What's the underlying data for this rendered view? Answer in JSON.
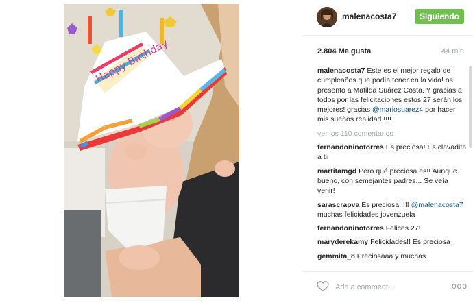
{
  "post": {
    "username": "malenacosta7",
    "follow_label": "Siguiendo",
    "likes": "2.804 Me gusta",
    "time": "44 min",
    "caption_user": "malenacosta7",
    "caption_text_1": "Este es el mejor regalo de cumpleaños que podía tener en la vida! os presento a Matilda Suárez Costa. Y gracias a todos por las felicitaciones estos 27 serán los mejores! gracias ",
    "caption_mention": "@mariosuarez4",
    "caption_text_2": " por hacer mis sueños realidad !!!!",
    "view_all": "ver los 110 comentarios",
    "hat_text": "Happy Birthday"
  },
  "comments": [
    {
      "user": "fernandoninotorres",
      "text": "Es preciosa! Es clavadita a tii"
    },
    {
      "user": "martitamgd",
      "text": "Pero qué preciosa es!! Aunque bueno, con semejantes padres... Se veía venir!"
    },
    {
      "user": "sarascrapva",
      "text": "Es preciosa!!!!!",
      "mention": "@malenacosta7",
      "text_after": " muchas felicidades jovenzuela"
    },
    {
      "user": "fernandoninotorres",
      "text": "Felices 27!"
    },
    {
      "user": "maryderekamy",
      "text": "Felicidades!! Es preciosa"
    },
    {
      "user": "gemmita_8",
      "text": "Preciosaaa y muchas"
    }
  ],
  "footer": {
    "add_comment_placeholder": "Add a comment...",
    "more": "ooo"
  },
  "colors": {
    "follow": "#70c050",
    "mention": "#125688",
    "muted": "#a5a7aa"
  }
}
